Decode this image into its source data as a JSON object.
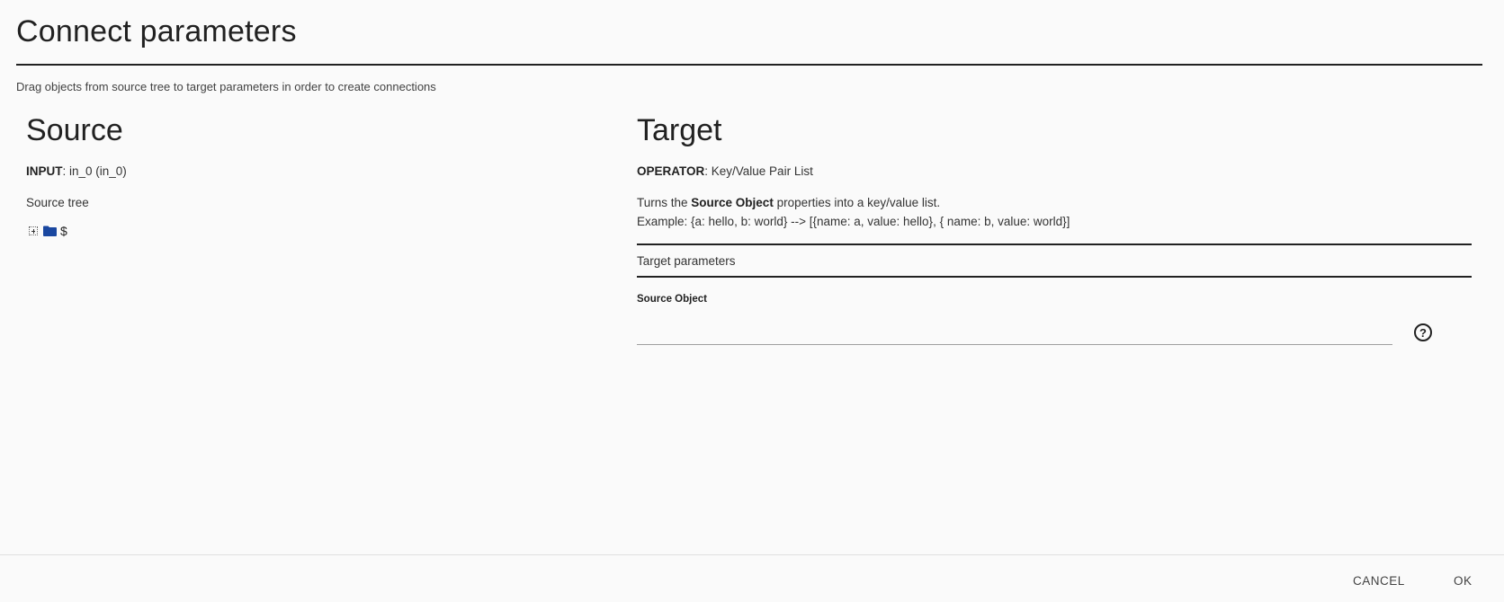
{
  "dialog": {
    "title": "Connect parameters",
    "subtitle": "Drag objects from source tree to target parameters in order to create connections"
  },
  "source": {
    "heading": "Source",
    "input_label": "INPUT",
    "input_value": ": in_0 (in_0)",
    "tree_label": "Source tree",
    "tree_root": "$"
  },
  "target": {
    "heading": "Target",
    "operator_label": "OPERATOR",
    "operator_value": ": Key/Value Pair List",
    "desc_prefix": "Turns the ",
    "desc_bold": "Source Object",
    "desc_suffix": " properties into a key/value list.",
    "example": "Example: {a: hello, b: world} --> [{name: a, value: hello}, { name: b, value: world}]",
    "params_heading": "Target parameters",
    "field_label": "Source Object",
    "field_value": ""
  },
  "footer": {
    "cancel_label": "CANCEL",
    "ok_label": "OK"
  },
  "icons": {
    "tree_expander": "plus-box-icon",
    "folder": "folder-icon",
    "help": "help-circle-icon"
  },
  "colors": {
    "folder": "#1a47a0",
    "background": "#fafafa",
    "text": "#212121"
  }
}
